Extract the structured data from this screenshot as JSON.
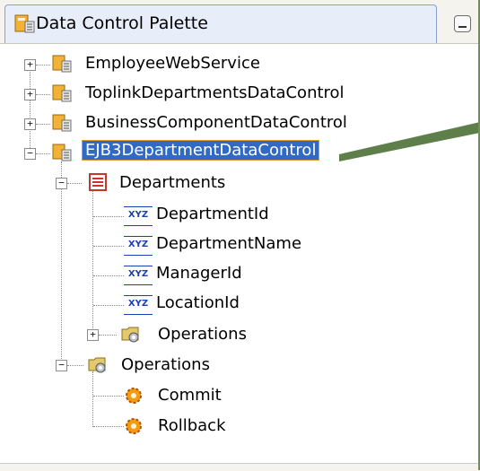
{
  "panel": {
    "title": "Data Control Palette",
    "icon": "data-control-icon",
    "minimize_icon": "minimize-icon"
  },
  "tree": {
    "nodes": [
      {
        "label": "EmployeeWebService",
        "icon": "data-control-icon",
        "expander": "+"
      },
      {
        "label": "ToplinkDepartmentsDataControl",
        "icon": "data-control-icon",
        "expander": "+"
      },
      {
        "label": "BusinessComponentDataControl",
        "icon": "data-control-icon",
        "expander": "+"
      },
      {
        "label": "EJB3DepartmentDataControl",
        "icon": "data-control-icon",
        "expander": "−",
        "selected": true
      },
      {
        "label": "Departments",
        "icon": "collection-icon",
        "expander": "−"
      },
      {
        "label": "DepartmentId",
        "icon": "attribute-icon"
      },
      {
        "label": "DepartmentName",
        "icon": "attribute-icon"
      },
      {
        "label": "ManagerId",
        "icon": "attribute-icon"
      },
      {
        "label": "LocationId",
        "icon": "attribute-icon"
      },
      {
        "label": "Operations",
        "icon": "operations-folder-icon",
        "expander": "+"
      },
      {
        "label": "Operations",
        "icon": "operations-folder-icon",
        "expander": "−"
      },
      {
        "label": "Commit",
        "icon": "operation-gear-icon"
      },
      {
        "label": "Rollback",
        "icon": "operation-gear-icon"
      }
    ],
    "attribute_icon_text": "XYZ"
  },
  "colors": {
    "selection": "#316ac5",
    "selection_border": "#e09a2a",
    "arrow": "#5f7f4a"
  }
}
